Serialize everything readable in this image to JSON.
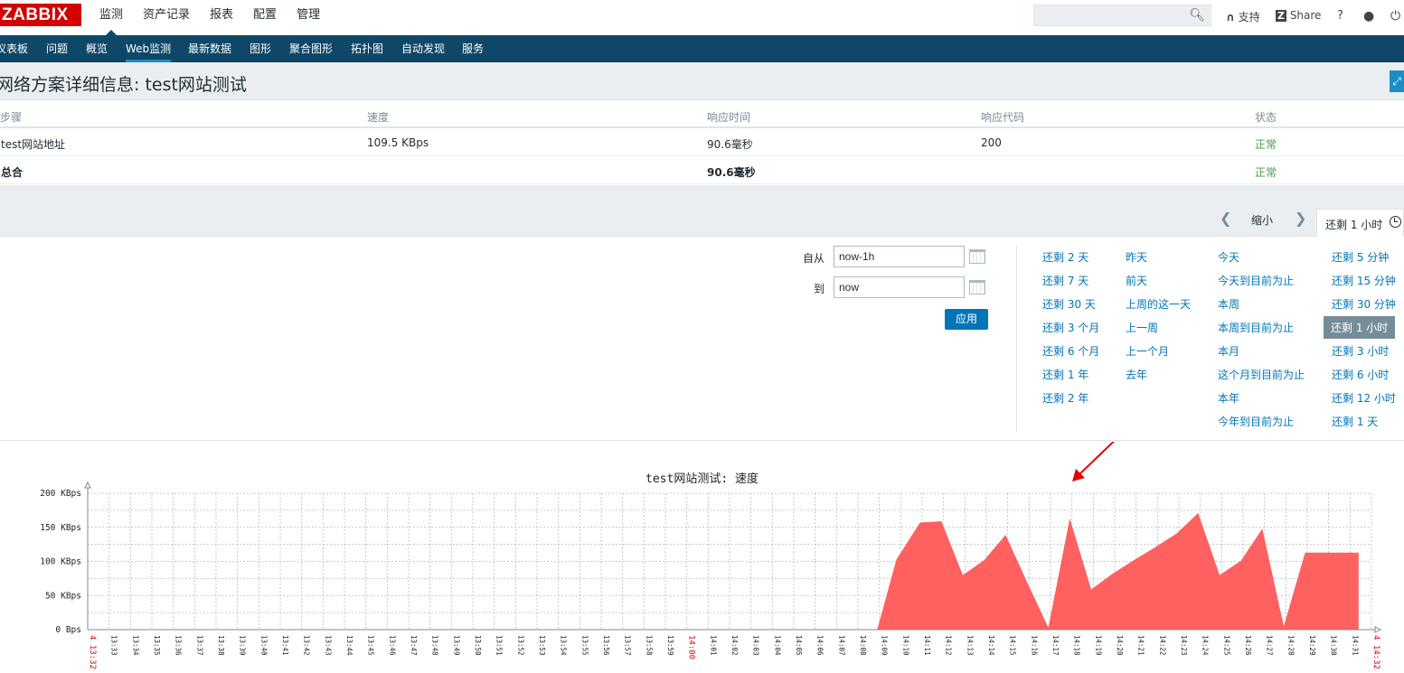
{
  "app": {
    "logo": "ZABBIX",
    "top_nav": [
      "监测",
      "资产记录",
      "报表",
      "配置",
      "管理"
    ],
    "active_top": "监测",
    "support_label": "支持",
    "share_label": "Share",
    "help_label": "?",
    "sub_nav": [
      "仪表板",
      "问题",
      "概览",
      "Web监测",
      "最新数据",
      "图形",
      "聚合图形",
      "拓扑图",
      "自动发现",
      "服务"
    ],
    "active_sub": "Web监测"
  },
  "page": {
    "title": "网络方案详细信息: test网站测试"
  },
  "table": {
    "headers": [
      "步骤",
      "速度",
      "响应时间",
      "响应代码",
      "状态"
    ],
    "rows": [
      {
        "step": "test网站地址",
        "speed": "109.5 KBps",
        "response_time": "90.6毫秒",
        "response_code": "200",
        "status": "正常"
      },
      {
        "step": "总合",
        "speed": "",
        "response_time": "90.6毫秒",
        "response_code": "",
        "status": "正常"
      }
    ]
  },
  "filter": {
    "zoom_out_label": "缩小",
    "tab_label": "还剩 1 小时",
    "from_label": "自从",
    "from_value": "now-1h",
    "to_label": "到",
    "to_value": "now",
    "apply_label": "应用",
    "quick_ranges": [
      [
        "还剩 2 天",
        "还剩 7 天",
        "还剩 30 天",
        "还剩 3 个月",
        "还剩 6 个月",
        "还剩 1 年",
        "还剩 2 年"
      ],
      [
        "昨天",
        "前天",
        "上周的这一天",
        "上一周",
        "上一个月",
        "去年"
      ],
      [
        "今天",
        "今天到目前为止",
        "本周",
        "本周到目前为止",
        "本月",
        "这个月到目前为止",
        "本年",
        "今年到目前为止"
      ],
      [
        "还剩 5 分钟",
        "还剩 15 分钟",
        "还剩 30 分钟",
        "还剩 1 小时",
        "还剩 3 小时",
        "还剩 6 小时",
        "还剩 12 小时",
        "还剩 1 天"
      ]
    ],
    "selected_range": "还剩 1 小时"
  },
  "chart_data": {
    "type": "area",
    "title": "test网站测试: 速度",
    "y_ticks": [
      "0 Bps",
      "50 KBps",
      "100 KBps",
      "150 KBps",
      "200 KBps"
    ],
    "ylim": [
      0,
      200
    ],
    "y_unit": "KBps",
    "x_start_label": "4 13:32",
    "x_end_label": "4 14:32",
    "x_ticks": [
      "13:33",
      "13:34",
      "13:35",
      "13:36",
      "13:37",
      "13:38",
      "13:39",
      "13:40",
      "13:41",
      "13:42",
      "13:43",
      "13:44",
      "13:45",
      "13:46",
      "13:47",
      "13:48",
      "13:49",
      "13:50",
      "13:51",
      "13:52",
      "13:53",
      "13:54",
      "13:55",
      "13:56",
      "13:57",
      "13:58",
      "13:59",
      "14:00",
      "14:01",
      "14:02",
      "14:03",
      "14:04",
      "14:05",
      "14:06",
      "14:07",
      "14:08",
      "14:09",
      "14:10",
      "14:11",
      "14:12",
      "14:13",
      "14:14",
      "14:15",
      "14:16",
      "14:17",
      "14:18",
      "14:19",
      "14:20",
      "14:21",
      "14:22",
      "14:23",
      "14:24",
      "14:25",
      "14:26",
      "14:27",
      "14:28",
      "14:29",
      "14:30",
      "14:31"
    ],
    "highlight_ticks": [
      "14:00"
    ],
    "series": [
      {
        "color": "#ff6060",
        "x_minutes": [
          36.9,
          37.8,
          38.9,
          39.9,
          40.9,
          41.9,
          42.9,
          43.9,
          44.9,
          45.9,
          46.9,
          47.9,
          48.9,
          49.9,
          50.9,
          51.9,
          52.9,
          53.9,
          54.9,
          55.9,
          56.9,
          57.9,
          58.9,
          59.4
        ],
        "values": [
          0,
          103,
          157,
          159,
          80,
          102,
          139,
          70,
          3,
          163,
          59,
          82,
          102,
          121,
          141,
          171,
          80,
          101,
          148,
          5,
          113,
          113,
          113,
          113
        ]
      }
    ]
  }
}
